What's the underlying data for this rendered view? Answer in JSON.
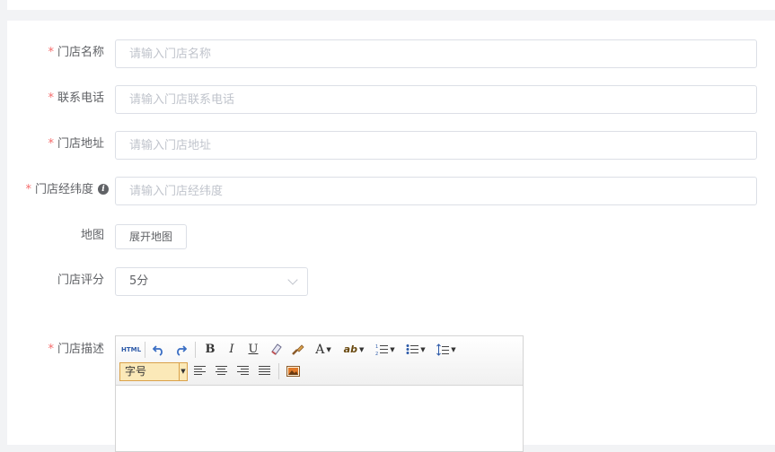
{
  "form": {
    "required_mark": "*",
    "store_name": {
      "label": "门店名称",
      "placeholder": "请输入门店名称",
      "value": ""
    },
    "store_phone": {
      "label": "联系电话",
      "placeholder": "请输入门店联系电话",
      "value": ""
    },
    "store_address": {
      "label": "门店地址",
      "placeholder": "请输入门店地址",
      "value": ""
    },
    "store_coords": {
      "label": "门店经纬度",
      "placeholder": "请输入门店经纬度",
      "value": "",
      "info_glyph": "i"
    },
    "map": {
      "label": "地图",
      "button_label": "展开地图"
    },
    "rating": {
      "label": "门店评分",
      "selected": "5分"
    },
    "description": {
      "label": "门店描述"
    }
  },
  "editor": {
    "toolbar": {
      "html_label": "HTML",
      "bold_label": "B",
      "italic_label": "I",
      "underline_label": "U",
      "font_color_label": "A",
      "highlight_label": "ab",
      "font_size_label": "字号"
    }
  },
  "colors": {
    "required": "#f56c6c",
    "border": "#dcdfe6",
    "placeholder": "#c0c4cc",
    "text": "#606266"
  }
}
